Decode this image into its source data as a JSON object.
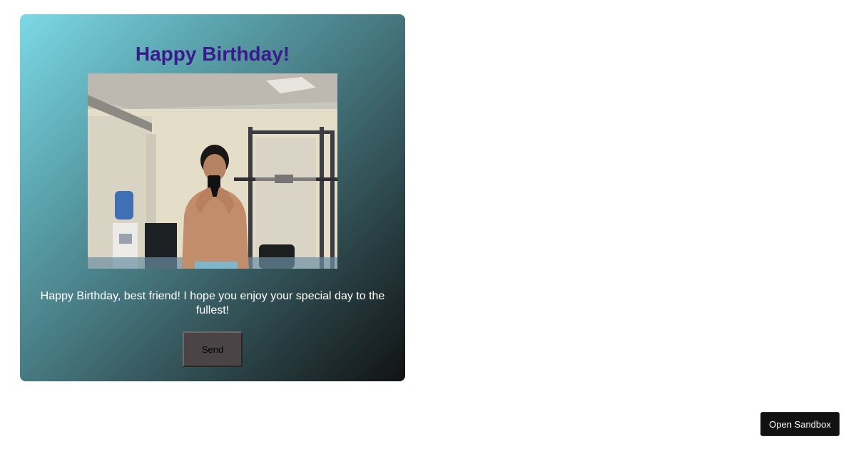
{
  "card": {
    "title": "Happy Birthday!",
    "message": "Happy Birthday, best friend! I hope you enjoy your special day to the fullest!",
    "send_label": "Send",
    "colors": {
      "title": "#3a1a8c",
      "gradient_start": "#7dd9e6",
      "gradient_end": "#111314",
      "button_bg": "#4a4446"
    }
  },
  "photo": {
    "description_icon": "photo-image"
  },
  "sandbox": {
    "label": "Open Sandbox"
  }
}
